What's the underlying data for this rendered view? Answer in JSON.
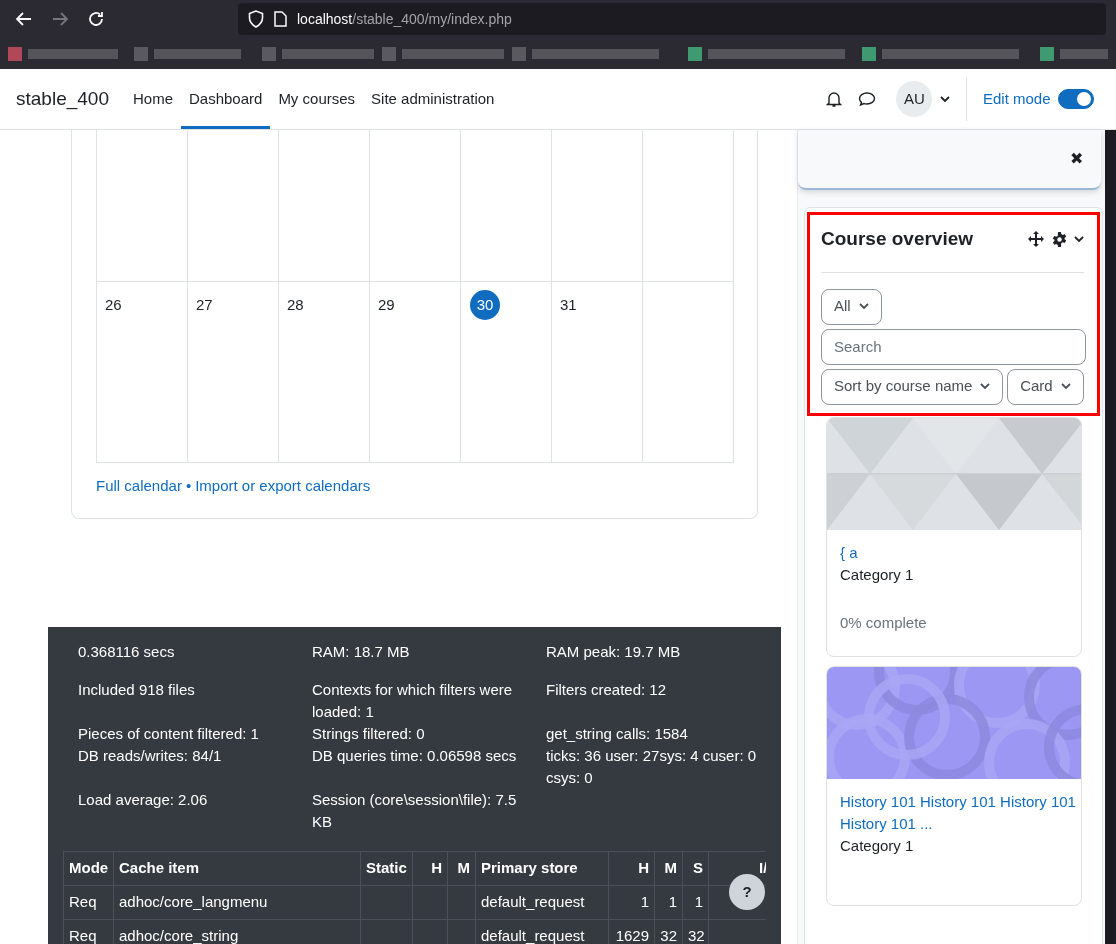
{
  "browser": {
    "url_host": "localhost",
    "url_path": "/stable_400/my/index.php"
  },
  "navbar": {
    "brand": "stable_400",
    "links": [
      {
        "label": "Home",
        "selected": false
      },
      {
        "label": "Dashboard",
        "selected": true
      },
      {
        "label": "My courses",
        "selected": false
      },
      {
        "label": "Site administration",
        "selected": false
      }
    ],
    "avatar": "AU",
    "edit_mode": {
      "label": "Edit mode",
      "on": true
    }
  },
  "calendar": {
    "days": [
      {
        "label": "26",
        "today": false
      },
      {
        "label": "27",
        "today": false
      },
      {
        "label": "28",
        "today": false
      },
      {
        "label": "29",
        "today": false
      },
      {
        "label": "30",
        "today": true
      },
      {
        "label": "31",
        "today": false
      }
    ],
    "links": [
      "Full calendar",
      "Import or export calendars"
    ],
    "separator": "•"
  },
  "performance": {
    "items": [
      "0.368116 secs",
      "RAM: 18.7 MB",
      "RAM peak: 19.7 MB",
      "Included 918 files",
      "Contexts for which filters were loaded: 1",
      "Filters created: 12",
      "Pieces of content filtered: 1",
      "Strings filtered: 0",
      "get_string calls: 1584",
      "DB reads/writes: 84/1",
      "DB queries time: 0.06598 secs",
      "ticks: 36 user: 27sys: 4 cuser: 0 csys: 0",
      "Load average: 2.06",
      "Session (core\\session\\file): 7.5 KB"
    ],
    "cache_table": {
      "columns": [
        "Mode",
        "Cache item",
        "Static",
        "H",
        "M",
        "Primary store",
        "H",
        "M",
        "S",
        "I/"
      ],
      "rows": [
        [
          "Req",
          "adhoc/core_langmenu",
          null,
          null,
          null,
          "default_request",
          "1",
          "1",
          "1",
          null
        ],
        [
          "Req",
          "adhoc/core_string",
          null,
          null,
          null,
          "default_request",
          "1629",
          "32",
          "32",
          null
        ]
      ]
    }
  },
  "help_button": "?",
  "drawer": {
    "close": "✖",
    "course_overview": {
      "title": "Course overview",
      "highlighted": true,
      "filter": "All",
      "search": {
        "placeholder": "Search"
      },
      "sort": "Sort by course name",
      "view": "Card",
      "courses": [
        {
          "title": "{ a",
          "category": "Category 1",
          "progress": "0% complete",
          "level": 0
        },
        {
          "title": "History 101 History 101 History 101 History 101 ...",
          "category": "Category 1"
        }
      ]
    }
  }
}
